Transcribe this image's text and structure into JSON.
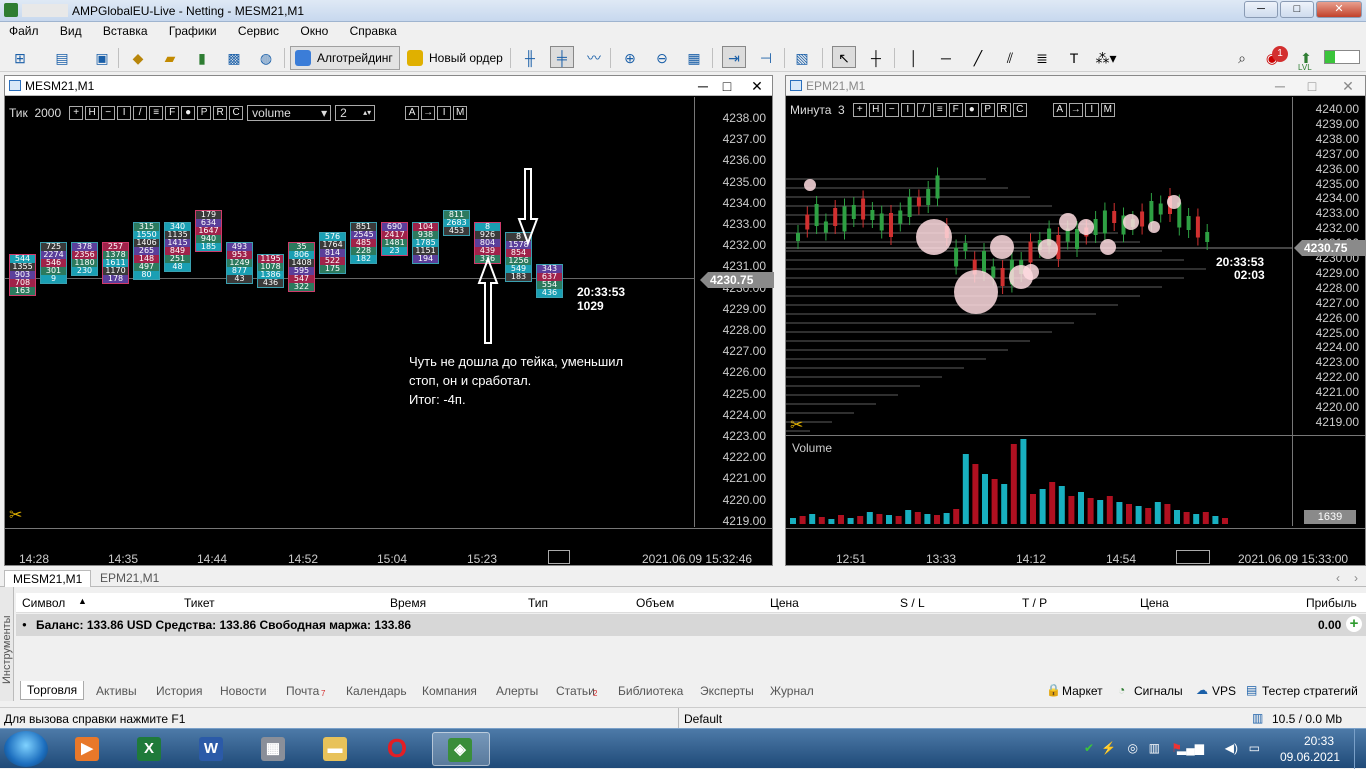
{
  "window": {
    "title": "AMPGlobalEU-Live - Netting - MESM21,M1"
  },
  "menu": [
    "Файл",
    "Вид",
    "Вставка",
    "Графики",
    "Сервис",
    "Окно",
    "Справка"
  ],
  "toolbar": {
    "algo_label": "Алготрейдинг",
    "order_label": "Новый ордер",
    "notif_count": "1",
    "lvl_label": "LVL"
  },
  "left_chart": {
    "title": "MESM21,M1",
    "timeframe": "Тик",
    "period": "2000",
    "cmd_keys": [
      "+",
      "H",
      "−",
      "I",
      "/",
      "≡",
      "F",
      "●",
      "P",
      "R",
      "C"
    ],
    "mode_keys": [
      "A",
      "→",
      "I",
      "M"
    ],
    "volume_select": "volume",
    "volume_num": "2",
    "y_ticks": [
      "4238.00",
      "4237.00",
      "4236.00",
      "4235.00",
      "4234.00",
      "4233.00",
      "4232.00",
      "4231.00",
      "4230.00",
      "4229.00",
      "4228.00",
      "4227.00",
      "4226.00",
      "4225.00",
      "4224.00",
      "4223.00",
      "4222.00",
      "4221.00",
      "4220.00",
      "4219.00"
    ],
    "x_ticks": [
      "14:28",
      "14:35",
      "14:44",
      "14:52",
      "15:04",
      "15:23"
    ],
    "datetime": "2021.06.09 15:32:46",
    "price_tag": "4230.75",
    "clock": "20:33:53",
    "ticks_left": "1029",
    "annotation": [
      "Чуть не дошла до тейка, уменьшил",
      "стоп, он и сработал.",
      "Итог: -4п."
    ],
    "cluster_numbers": [
      [
        "544",
        "1355",
        "903",
        "708",
        "163"
      ],
      [
        "725",
        "2274",
        "546",
        "301",
        "9"
      ],
      [
        "378",
        "2356",
        "1180",
        "230"
      ],
      [
        "257",
        "1378",
        "1611",
        "1170",
        "178"
      ],
      [
        "315",
        "1550",
        "1406",
        "265",
        "148",
        "497",
        "80"
      ],
      [
        "340",
        "1135",
        "1415",
        "849",
        "251",
        "48"
      ],
      [
        "179",
        "634",
        "1647",
        "940",
        "185"
      ],
      [
        "493",
        "953",
        "1249",
        "877",
        "43"
      ],
      [
        "1195",
        "1078",
        "1386",
        "436"
      ],
      [
        "35",
        "806",
        "1408",
        "595",
        "547",
        "322"
      ],
      [
        "576",
        "1764",
        "814",
        "522",
        "175"
      ],
      [
        "851",
        "2545",
        "485",
        "228",
        "182"
      ],
      [
        "690",
        "2417",
        "1481",
        "23"
      ],
      [
        "104",
        "938",
        "1785",
        "1151",
        "194"
      ],
      [
        "811",
        "2683",
        "453"
      ],
      [
        "8",
        "926",
        "804",
        "439",
        "336"
      ],
      [
        "8",
        "1578",
        "854",
        "1256",
        "549",
        "183"
      ],
      [
        "343",
        "637",
        "554",
        "436"
      ]
    ]
  },
  "right_chart": {
    "title": "EPM21,M1",
    "timeframe": "Минута",
    "period": "3",
    "cmd_keys": [
      "+",
      "H",
      "−",
      "I",
      "/",
      "≡",
      "F",
      "●",
      "P",
      "R",
      "C"
    ],
    "mode_keys": [
      "A",
      "→",
      "I",
      "M"
    ],
    "y_ticks": [
      "4240.00",
      "4239.00",
      "4238.00",
      "4237.00",
      "4236.00",
      "4235.00",
      "4234.00",
      "4233.00",
      "4232.00",
      "4231.00",
      "4230.00",
      "4229.00",
      "4228.00",
      "4227.00",
      "4226.00",
      "4225.00",
      "4224.00",
      "4223.00",
      "4222.00",
      "4221.00",
      "4220.00",
      "4219.00"
    ],
    "x_ticks": [
      "12:51",
      "13:33",
      "14:12",
      "14:54"
    ],
    "datetime": "2021.06.09 15:33:00",
    "price_tag": "4230.75",
    "clock": "20:33:53",
    "countdown": "02:03",
    "volume_label": "Volume",
    "volume_value": "1639"
  },
  "chart_tabs": [
    "MESM21,M1",
    "EPM21,M1"
  ],
  "trade": {
    "columns": [
      "Символ",
      "Тикет",
      "Время",
      "Тип",
      "Объем",
      "Цена",
      "S / L",
      "T / P",
      "Цена",
      "Прибыль"
    ],
    "balance_text": "Баланс: 133.86 USD  Средства: 133.86  Свободная маржа: 133.86",
    "profit": "0.00",
    "side_label": "Инструменты"
  },
  "toolbox_tabs": [
    "Торговля",
    "Активы",
    "История",
    "Новости",
    "Почта",
    "Календарь",
    "Компания",
    "Алерты",
    "Статьи",
    "Библиотека",
    "Эксперты",
    "Журнал"
  ],
  "toolbox_badges": {
    "mail": "7",
    "articles": "2"
  },
  "toolbox_right": [
    "Маркет",
    "Сигналы",
    "VPS",
    "Тестер стратегий"
  ],
  "status": {
    "help": "Для вызова справки нажмите F1",
    "profile": "Default",
    "traffic": "10.5 / 0.0 Mb"
  },
  "taskbar": {
    "time": "20:33",
    "date": "09.06.2021"
  }
}
